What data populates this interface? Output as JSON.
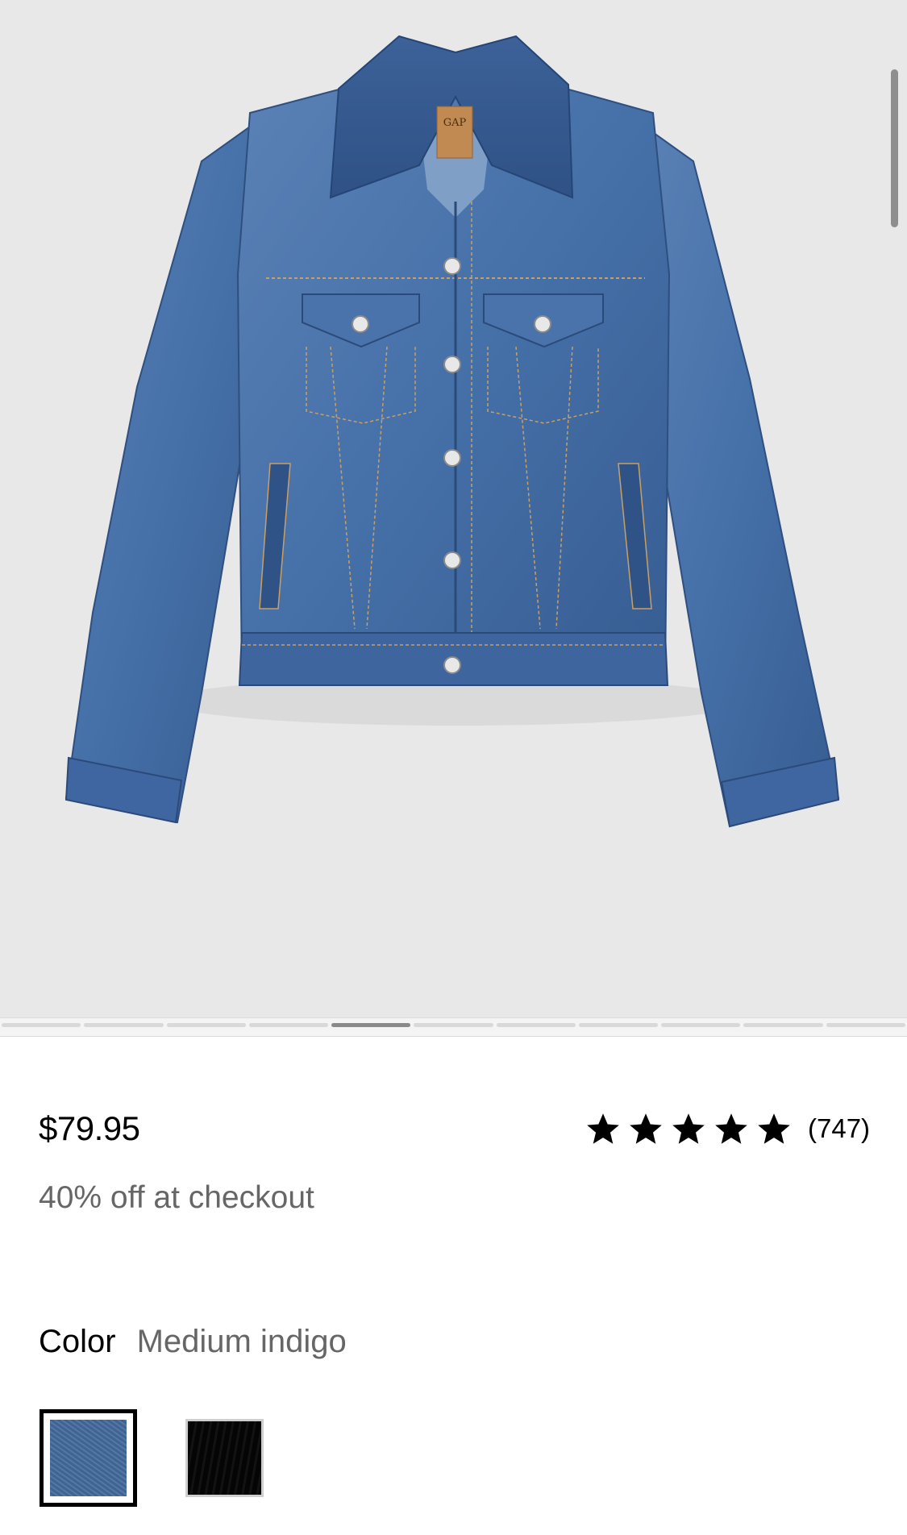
{
  "product": {
    "image_alt": "Medium indigo denim jacket",
    "brand_tag": "GAP",
    "price": "$79.95",
    "promo": "40% off at checkout",
    "rating": {
      "stars": 5,
      "review_count": "(747)"
    }
  },
  "color": {
    "label": "Color",
    "selected": "Medium indigo",
    "swatches": [
      {
        "name": "Medium indigo",
        "hex": "#436a9c",
        "selected": true
      },
      {
        "name": "Black",
        "hex": "#050505",
        "selected": false
      }
    ]
  },
  "carousel": {
    "total": 11,
    "active_index": 4
  },
  "colors": {
    "hero_bg": "#e8e8e8",
    "muted_text": "#666666"
  }
}
